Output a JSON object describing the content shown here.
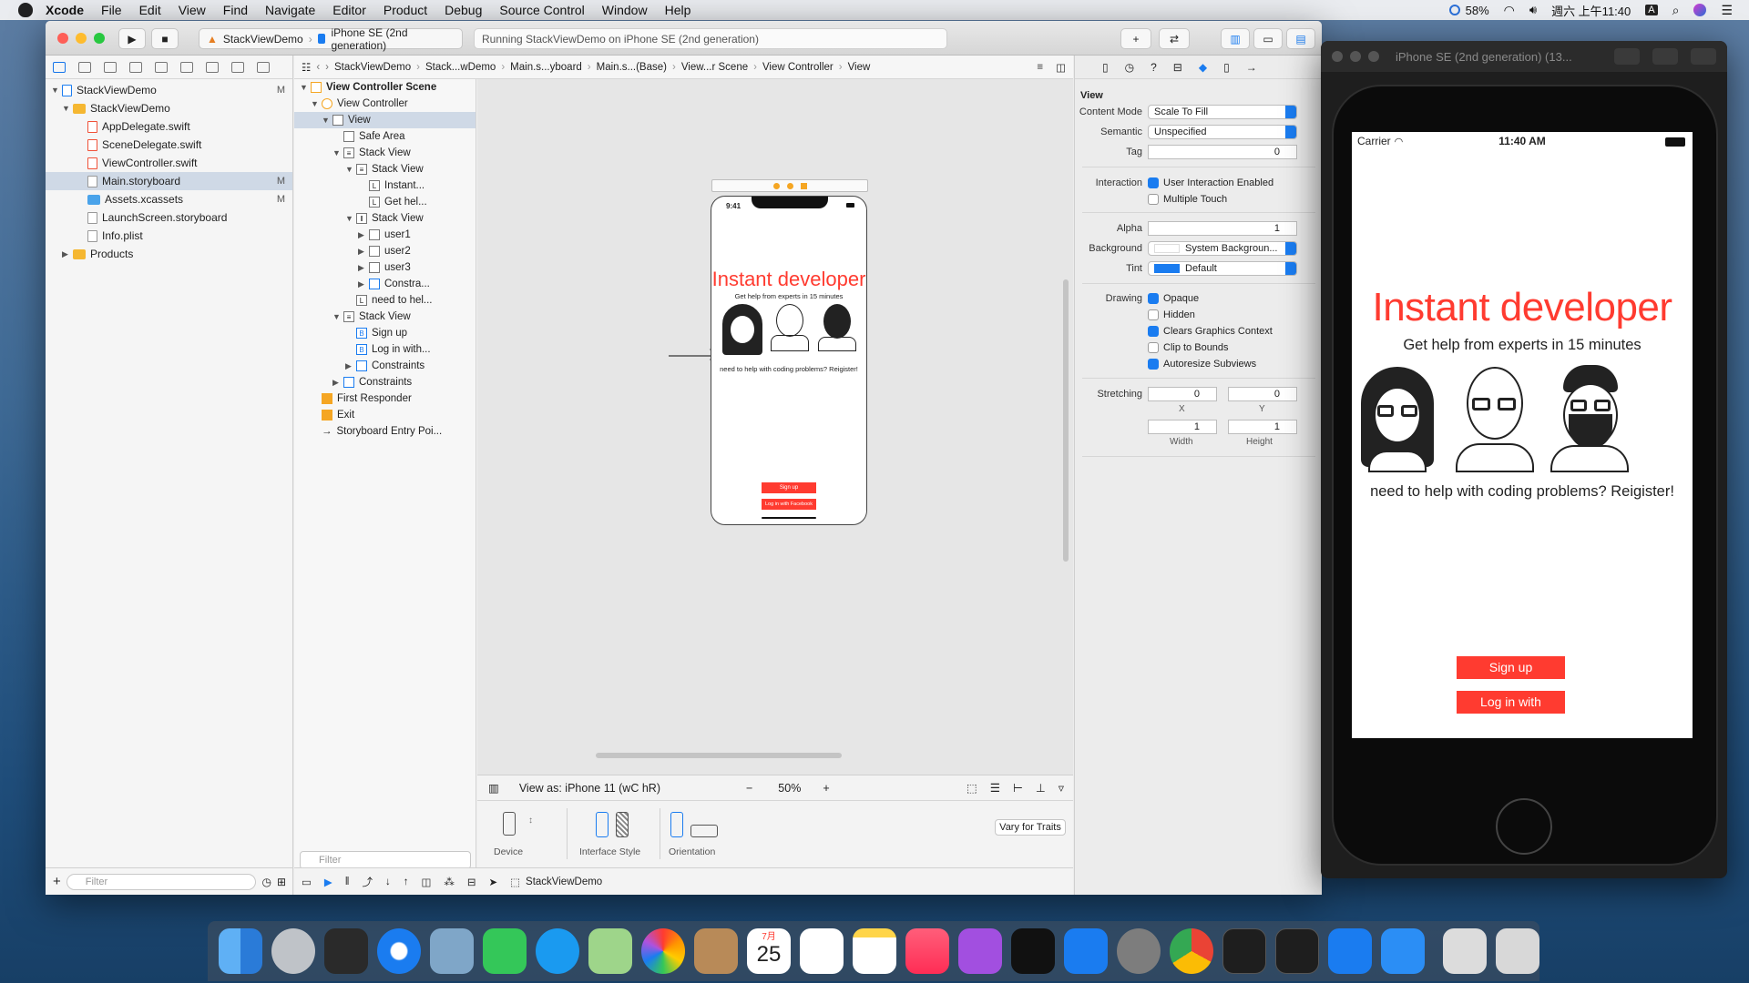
{
  "menubar": {
    "app": "Xcode",
    "items": [
      "File",
      "Edit",
      "View",
      "Find",
      "Navigate",
      "Editor",
      "Product",
      "Debug",
      "Source Control",
      "Window",
      "Help"
    ],
    "battery": "58%",
    "clock": "週六 上午11:40",
    "input_method": "A"
  },
  "toolbar": {
    "scheme_target": "StackViewDemo",
    "scheme_device": "iPhone SE (2nd generation)",
    "status": "Running StackViewDemo on iPhone SE (2nd generation)"
  },
  "navigator": {
    "items": [
      {
        "label": "StackViewDemo",
        "badge": "M"
      },
      {
        "label": "StackViewDemo",
        "badge": ""
      },
      {
        "label": "AppDelegate.swift",
        "badge": ""
      },
      {
        "label": "SceneDelegate.swift",
        "badge": ""
      },
      {
        "label": "ViewController.swift",
        "badge": ""
      },
      {
        "label": "Main.storyboard",
        "badge": "M"
      },
      {
        "label": "Assets.xcassets",
        "badge": "M"
      },
      {
        "label": "LaunchScreen.storyboard",
        "badge": ""
      },
      {
        "label": "Info.plist",
        "badge": ""
      },
      {
        "label": "Products",
        "badge": ""
      }
    ],
    "filter_placeholder": "Filter"
  },
  "jumpbar": [
    "StackViewDemo",
    "Stack...wDemo",
    "Main.s...yboard",
    "Main.s...(Base)",
    "View...r Scene",
    "View Controller",
    "View"
  ],
  "outline": {
    "items": [
      "View Controller Scene",
      "View Controller",
      "View",
      "Safe Area",
      "Stack View",
      "Stack View",
      "Instant...",
      "Get hel...",
      "Stack View",
      "user1",
      "user2",
      "user3",
      "Constra...",
      "need to hel...",
      "Stack View",
      "Sign up",
      "Log in with...",
      "Constraints",
      "Constraints",
      "First Responder",
      "Exit",
      "Storyboard Entry Poi..."
    ],
    "filter_placeholder": "Filter"
  },
  "canvas": {
    "view_as": "View as: iPhone 11 (wC hR)",
    "zoom": "50%",
    "device_label": "Device",
    "interface_style_label": "Interface Style",
    "orientation_label": "Orientation",
    "vary_for_traits": "Vary for Traits",
    "bottom_label": "StackViewDemo"
  },
  "app_screen": {
    "time_small": "9:41",
    "title": "Instant developer",
    "subtitle": "Get help from experts in 15 minutes",
    "prompt": "need to help with coding problems? Reigister!",
    "signup": "Sign up",
    "facebook": "Log in with Facebook",
    "accent": "#ff3b30"
  },
  "inspector": {
    "section": "View",
    "content_mode_label": "Content Mode",
    "content_mode": "Scale To Fill",
    "semantic_label": "Semantic",
    "semantic": "Unspecified",
    "tag_label": "Tag",
    "tag": "0",
    "interaction_label": "Interaction",
    "user_interaction": "User Interaction Enabled",
    "multiple_touch": "Multiple Touch",
    "alpha_label": "Alpha",
    "alpha": "1",
    "background_label": "Background",
    "background": "System Backgroun...",
    "tint_label": "Tint",
    "tint": "Default",
    "drawing_label": "Drawing",
    "opaque": "Opaque",
    "hidden": "Hidden",
    "clears": "Clears Graphics Context",
    "clip": "Clip to Bounds",
    "autoresize": "Autoresize Subviews",
    "stretching_label": "Stretching",
    "stretch_x": "0",
    "stretch_y": "0",
    "stretch_w": "1",
    "stretch_h": "1",
    "x_label": "X",
    "y_label": "Y",
    "width_label": "Width",
    "height_label": "Height"
  },
  "simulator": {
    "title": "iPhone SE (2nd generation) (13...",
    "carrier": "Carrier",
    "time": "11:40 AM"
  },
  "desktop": {
    "calendar_month": "7月",
    "calendar_day": "25"
  }
}
